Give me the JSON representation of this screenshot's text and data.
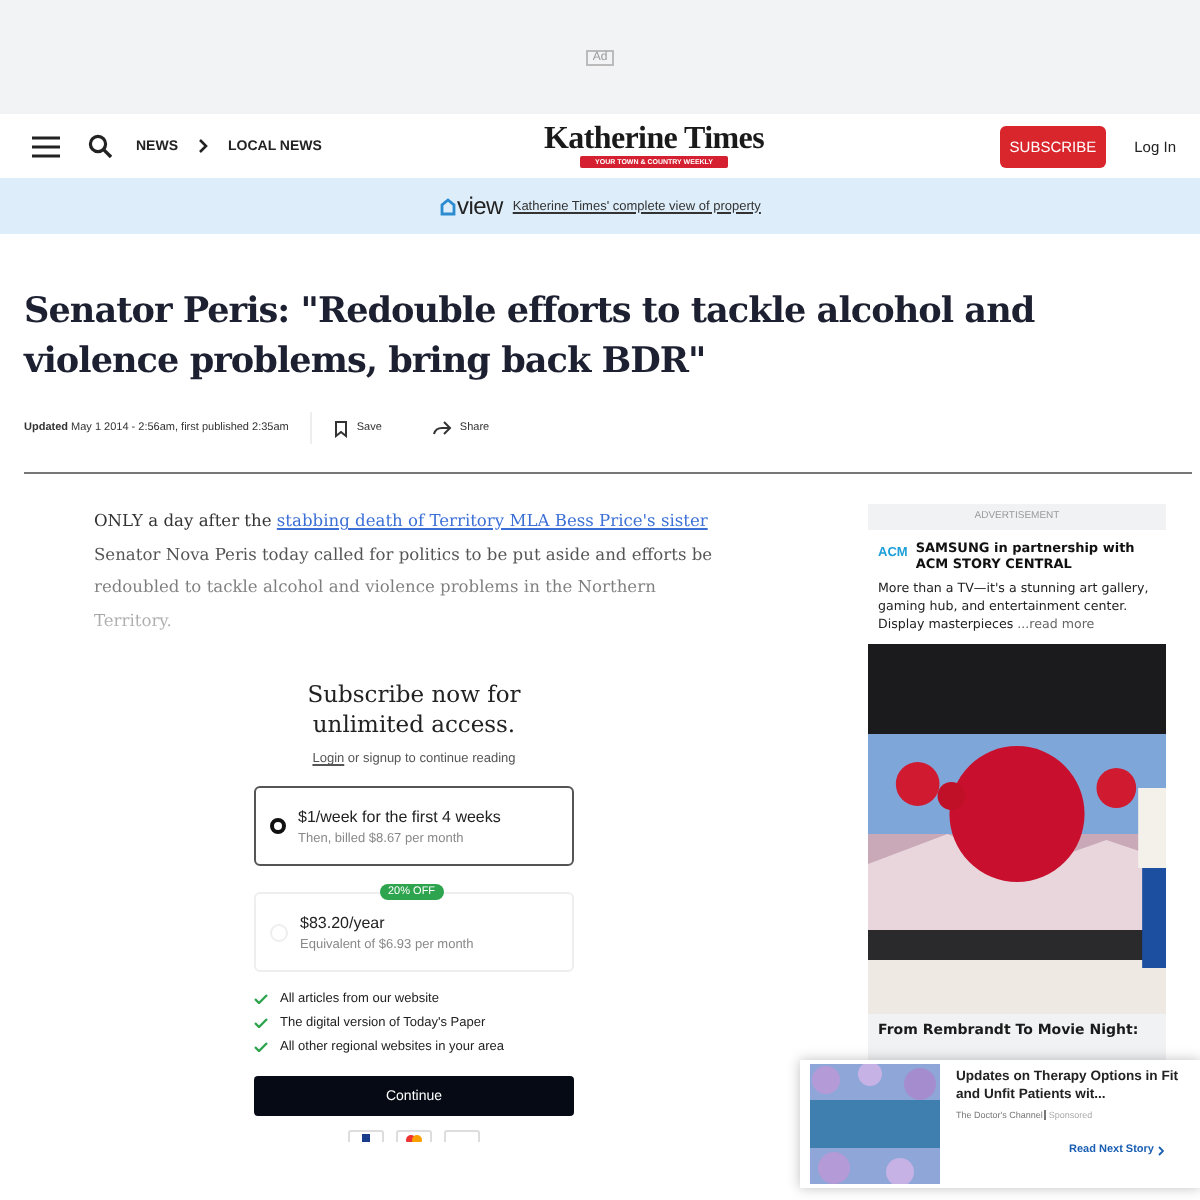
{
  "top_ad": {
    "label": "Ad"
  },
  "header": {
    "breadcrumbs": [
      "NEWS",
      "LOCAL NEWS"
    ],
    "logo": {
      "name": "Katherine Times",
      "tagline": "YOUR TOWN & COUNTRY WEEKLY"
    },
    "subscribe": "SUBSCRIBE",
    "login": "Log In"
  },
  "promo": {
    "brand": "view",
    "link": "Katherine Times' complete view of property"
  },
  "article": {
    "headline": "Senator Peris: \"Redouble efforts to tackle alcohol and violence problems, bring back BDR\"",
    "updated_label": "Updated",
    "updated": "May 1 2014 - 2:56am, first published 2:35am",
    "save": "Save",
    "share": "Share",
    "intro_before": "ONLY a day after the",
    "intro_link": "stabbing death of Territory MLA Bess Price's sister",
    "intro_after": "Senator Nova Peris today called for politics to be put aside and efforts be redoubled to tackle alcohol and violence problems in the Northern Territory."
  },
  "paywall": {
    "title": "Subscribe now for unlimited access.",
    "login_link": "Login",
    "login_rest": "or signup to continue reading",
    "options": [
      {
        "price": "$1/week for the first 4 weeks",
        "detail": "Then, billed $8.67 per month",
        "selected": true
      },
      {
        "price": "$83.20/year",
        "detail": "Equivalent of $6.93 per month",
        "badge": "20% OFF",
        "selected": false
      }
    ],
    "benefits": [
      "All articles from our website",
      "The digital version of Today's Paper",
      "All other regional websites in your area"
    ],
    "button": "Continue"
  },
  "sidebar_ad": {
    "label": "ADVERTISEMENT",
    "brand": "ACM",
    "sponsor": "SAMSUNG in partnership with ACM STORY CENTRAL",
    "body": "More than a TV—it's a stunning art gallery, gaming hub, and entertainment center. Display masterpieces ",
    "more": "...read more",
    "caption": "From Rembrandt To Movie Night:"
  },
  "next_story": {
    "title": "Updates on Therapy Options in Fit and Unfit Patients wit...",
    "source": "The Doctor's Channel",
    "sponsored": "Sponsored",
    "cta": "Read Next Story"
  }
}
